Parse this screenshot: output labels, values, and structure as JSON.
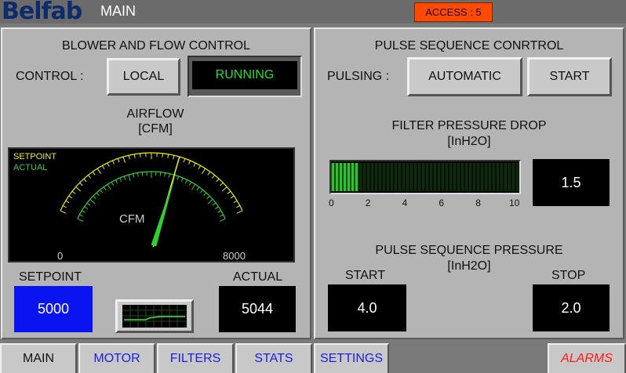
{
  "header": {
    "logo_text": "Belfab",
    "screen_title": "MAIN",
    "access_label": "ACCESS : 5"
  },
  "blower": {
    "title": "BLOWER AND  FLOW CONTROL",
    "control_label": "CONTROL :",
    "local_button": "LOCAL",
    "status": "RUNNING",
    "airflow_title": "AIRFLOW",
    "airflow_unit": "[CFM]",
    "gauge": {
      "legend_setpoint": "SETPOINT",
      "legend_actual": "ACTUAL",
      "unit_label": "CFM",
      "min_label": "0",
      "max_label": "8000",
      "min": 0,
      "max": 8000,
      "setpoint_value": 5000,
      "actual_value": 5044,
      "setpoint_color": "#f0f000",
      "actual_color": "#30d030"
    },
    "setpoint_label": "SETPOINT",
    "setpoint_value": "5000",
    "actual_label": "ACTUAL",
    "actual_value": "5044"
  },
  "pulse": {
    "title": "PULSE SEQUENCE CONRTROL",
    "pulsing_label": "PULSING :",
    "automatic_button": "AUTOMATIC",
    "start_button": "START",
    "filter_title": "FILTER PRESSURE DROP",
    "filter_unit": "[InH2O]",
    "filter_bar": {
      "min": 0,
      "max": 10,
      "value": 1.5,
      "ticks": [
        "0",
        "2",
        "4",
        "6",
        "8",
        "10"
      ]
    },
    "filter_value": "1.5",
    "sequence_title": "PULSE SEQUENCE PRESSURE",
    "sequence_unit": "[InH2O]",
    "start_label": "START",
    "start_value": "4.0",
    "stop_label": "STOP",
    "stop_value": "2.0"
  },
  "tabs": [
    {
      "label": "MAIN"
    },
    {
      "label": "MOTOR"
    },
    {
      "label": "FILTERS"
    },
    {
      "label": "STATS"
    },
    {
      "label": "SETTINGS"
    }
  ],
  "alarms_label": "ALARMS",
  "colors": {
    "setpoint_box": "#0a14f0",
    "alarm_text": "#ff1a1a",
    "access_bg": "#ff4a00",
    "bar_fill": "#30c030"
  }
}
